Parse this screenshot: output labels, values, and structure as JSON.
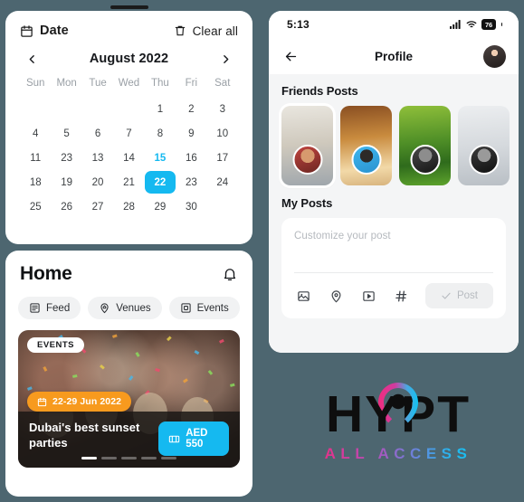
{
  "background_color": "#4d6670",
  "accent_color": "#15b9f0",
  "calendar_panel": {
    "header": {
      "title": "Date",
      "title_icon": "calendar-icon",
      "clear_label": "Clear all",
      "clear_icon": "trash-icon"
    },
    "month_label": "August 2022",
    "prev_icon": "chevron-left-icon",
    "next_icon": "chevron-right-icon",
    "weekdays": [
      "Sun",
      "Mon",
      "Tue",
      "Wed",
      "Thu",
      "Fri",
      "Sat"
    ],
    "weeks": [
      [
        {
          "d": "",
          "s": "empty"
        },
        {
          "d": "",
          "s": "empty"
        },
        {
          "d": "",
          "s": "empty"
        },
        {
          "d": "",
          "s": "empty"
        },
        {
          "d": "1",
          "s": "normal"
        },
        {
          "d": "2",
          "s": "normal"
        },
        {
          "d": "3",
          "s": "normal"
        }
      ],
      [
        {
          "d": "4",
          "s": "normal"
        },
        {
          "d": "5",
          "s": "normal"
        },
        {
          "d": "6",
          "s": "normal"
        },
        {
          "d": "7",
          "s": "normal"
        },
        {
          "d": "8",
          "s": "normal"
        },
        {
          "d": "9",
          "s": "normal"
        },
        {
          "d": "10",
          "s": "normal"
        }
      ],
      [
        {
          "d": "11",
          "s": "normal"
        },
        {
          "d": "23",
          "s": "normal"
        },
        {
          "d": "13",
          "s": "normal"
        },
        {
          "d": "14",
          "s": "normal"
        },
        {
          "d": "15",
          "s": "today"
        },
        {
          "d": "16",
          "s": "normal"
        },
        {
          "d": "17",
          "s": "normal"
        }
      ],
      [
        {
          "d": "18",
          "s": "normal"
        },
        {
          "d": "19",
          "s": "normal"
        },
        {
          "d": "20",
          "s": "normal"
        },
        {
          "d": "21",
          "s": "normal"
        },
        {
          "d": "22",
          "s": "selected"
        },
        {
          "d": "23",
          "s": "normal"
        },
        {
          "d": "24",
          "s": "normal"
        }
      ],
      [
        {
          "d": "25",
          "s": "normal"
        },
        {
          "d": "26",
          "s": "normal"
        },
        {
          "d": "27",
          "s": "normal"
        },
        {
          "d": "28",
          "s": "normal"
        },
        {
          "d": "29",
          "s": "normal"
        },
        {
          "d": "30",
          "s": "normal"
        },
        {
          "d": "",
          "s": "empty"
        }
      ]
    ],
    "today_color": "#15b9f0",
    "selected_color": "#15b9f0"
  },
  "home_panel": {
    "title": "Home",
    "bell_icon": "bell-icon",
    "chips": [
      {
        "label": "Feed",
        "icon": "feed-icon"
      },
      {
        "label": "Venues",
        "icon": "venue-pin-icon"
      },
      {
        "label": "Events",
        "icon": "events-icon"
      }
    ],
    "event_card": {
      "badge": "EVENTS",
      "date_chip": "22-29 Jun 2022",
      "date_chip_icon": "calendar-icon",
      "date_chip_color": "#f79a1e",
      "title": "Dubai's best sunset parties",
      "price": "AED 550",
      "price_icon": "ticket-icon",
      "price_color": "#15b9f0",
      "slides": 5,
      "active_slide": 1
    }
  },
  "phone_panel": {
    "status_bar": {
      "time": "5:13",
      "signal_icon": "cellular-signal-icon",
      "wifi_icon": "wifi-icon",
      "battery_level": "76"
    },
    "nav": {
      "back_icon": "arrow-left-icon",
      "title": "Profile",
      "avatar": "profile-avatar"
    },
    "friends_section_title": "Friends Posts",
    "friends_posts": [
      {
        "name": "story-1",
        "active": true
      },
      {
        "name": "story-2",
        "active": false
      },
      {
        "name": "story-3",
        "active": false
      },
      {
        "name": "story-4",
        "active": false
      }
    ],
    "my_posts_title": "My Posts",
    "composer": {
      "placeholder": "Customize your post",
      "value": "",
      "tools": [
        {
          "icon": "image-icon"
        },
        {
          "icon": "location-pin-icon"
        },
        {
          "icon": "video-icon"
        },
        {
          "icon": "hashtag-icon"
        }
      ],
      "post_label": "Post",
      "post_icon": "check-icon",
      "post_enabled": false
    }
  },
  "logo": {
    "h": "H",
    "y": "Y",
    "p": "P",
    "t": "T",
    "tagline": "ALL ACCESS",
    "gradient_start": "#ef2c7e",
    "gradient_end": "#12c3f2",
    "pin_icon": "location-pin-icon"
  }
}
